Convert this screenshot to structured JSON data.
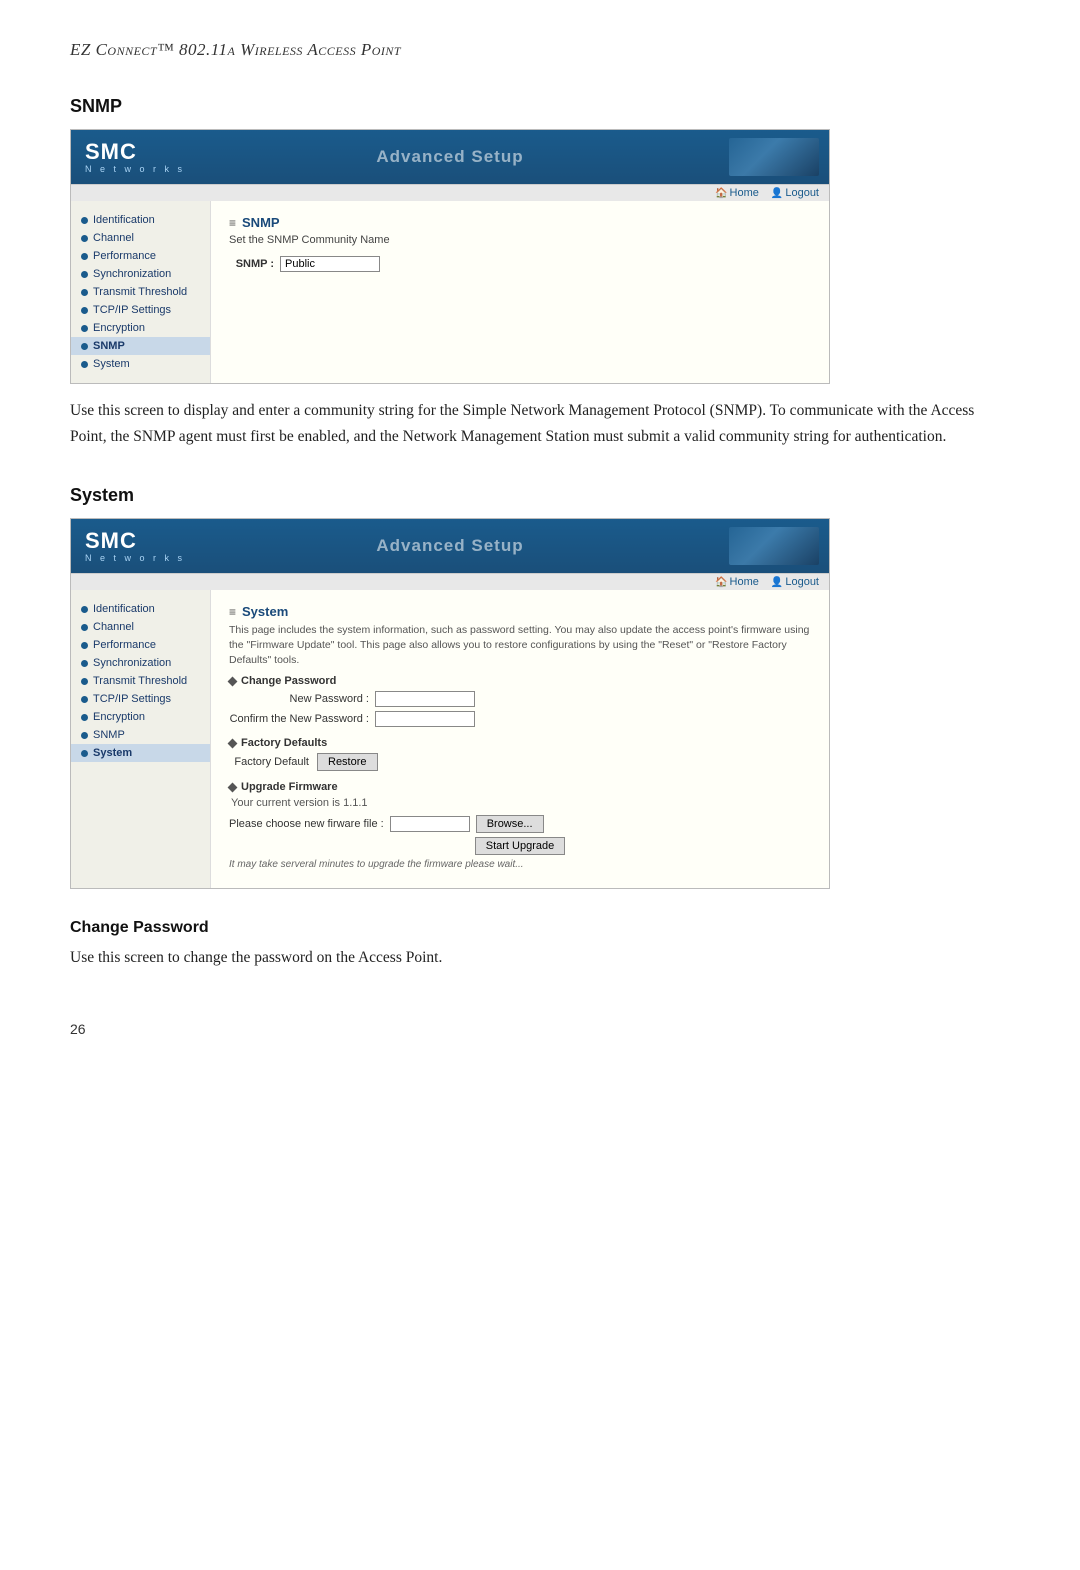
{
  "header": {
    "title": "EZ Connect™ 802.11a Wireless Access Point"
  },
  "snmp_section": {
    "title": "SNMP",
    "smc_logo": "SMC",
    "smc_networks": "N e t w o r k s",
    "advanced_setup": "Advanced Setup",
    "nav_home": "Home",
    "nav_logout": "Logout",
    "sidebar_items": [
      {
        "label": "Identification",
        "active": false
      },
      {
        "label": "Channel",
        "active": false
      },
      {
        "label": "Performance",
        "active": false
      },
      {
        "label": "Synchronization",
        "active": false
      },
      {
        "label": "Transmit Threshold",
        "active": false
      },
      {
        "label": "TCP/IP Settings",
        "active": false
      },
      {
        "label": "Encryption",
        "active": false
      },
      {
        "label": "SNMP",
        "active": true
      },
      {
        "label": "System",
        "active": false
      }
    ],
    "content_title": "SNMP",
    "content_subtitle": "Set the SNMP Community Name",
    "snmp_label": "SNMP :",
    "snmp_value": "Public",
    "description": "Use this screen to display and enter a community string for the Simple Network Management Protocol (SNMP). To communicate with the Access Point, the SNMP agent must first be enabled, and the Network Management Station must submit a valid community string for authentication."
  },
  "system_section": {
    "title": "System",
    "smc_logo": "SMC",
    "smc_networks": "N e t w o r k s",
    "advanced_setup": "Advanced Setup",
    "nav_home": "Home",
    "nav_logout": "Logout",
    "sidebar_items": [
      {
        "label": "Identification",
        "active": false
      },
      {
        "label": "Channel",
        "active": false
      },
      {
        "label": "Performance",
        "active": false
      },
      {
        "label": "Synchronization",
        "active": false
      },
      {
        "label": "Transmit Threshold",
        "active": false
      },
      {
        "label": "TCP/IP Settings",
        "active": false
      },
      {
        "label": "Encryption",
        "active": false
      },
      {
        "label": "SNMP",
        "active": false
      },
      {
        "label": "System",
        "active": true
      }
    ],
    "content_title": "System",
    "content_desc": "This page includes the system information, such as password setting. You may also update the access point's firmware using the \"Firmware Update\" tool. This page also allows you to restore configurations by using the \"Reset\" or \"Restore Factory Defaults\" tools.",
    "change_password_label": "Change Password",
    "new_password_label": "New Password :",
    "confirm_password_label": "Confirm the New Password :",
    "factory_defaults_label": "Factory Defaults",
    "factory_default_btn": "Factory Default",
    "restore_btn": "Restore",
    "upgrade_firmware_label": "Upgrade Firmware",
    "version_text": "Your current version is 1.1.1",
    "choose_file_label": "Please choose new firware file :",
    "browse_btn": "Browse...",
    "start_upgrade_btn": "Start Upgrade",
    "upgrade_note": "It may take serveral minutes to upgrade the firmware please wait..."
  },
  "bottom": {
    "change_password_title": "Change Password",
    "change_password_desc": "Use this screen to change the password on the Access Point.",
    "page_number": "26"
  }
}
